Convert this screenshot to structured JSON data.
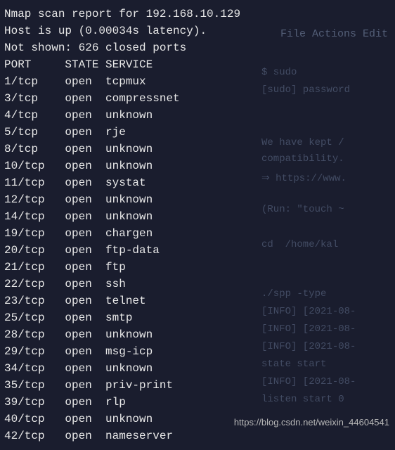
{
  "header": {
    "line1": "Nmap scan report for 192.168.10.129",
    "line2": "Host is up (0.00034s latency).",
    "line3": "Not shown: 626 closed ports"
  },
  "table_header": {
    "port": "PORT",
    "state": "STATE",
    "service": "SERVICE"
  },
  "ports": [
    {
      "port": "1/tcp",
      "state": "open",
      "service": "tcpmux"
    },
    {
      "port": "3/tcp",
      "state": "open",
      "service": "compressnet"
    },
    {
      "port": "4/tcp",
      "state": "open",
      "service": "unknown"
    },
    {
      "port": "5/tcp",
      "state": "open",
      "service": "rje"
    },
    {
      "port": "8/tcp",
      "state": "open",
      "service": "unknown"
    },
    {
      "port": "10/tcp",
      "state": "open",
      "service": "unknown"
    },
    {
      "port": "11/tcp",
      "state": "open",
      "service": "systat"
    },
    {
      "port": "12/tcp",
      "state": "open",
      "service": "unknown"
    },
    {
      "port": "14/tcp",
      "state": "open",
      "service": "unknown"
    },
    {
      "port": "19/tcp",
      "state": "open",
      "service": "chargen"
    },
    {
      "port": "20/tcp",
      "state": "open",
      "service": "ftp-data"
    },
    {
      "port": "21/tcp",
      "state": "open",
      "service": "ftp"
    },
    {
      "port": "22/tcp",
      "state": "open",
      "service": "ssh"
    },
    {
      "port": "23/tcp",
      "state": "open",
      "service": "telnet"
    },
    {
      "port": "25/tcp",
      "state": "open",
      "service": "smtp"
    },
    {
      "port": "28/tcp",
      "state": "open",
      "service": "unknown"
    },
    {
      "port": "29/tcp",
      "state": "open",
      "service": "msg-icp"
    },
    {
      "port": "34/tcp",
      "state": "open",
      "service": "unknown"
    },
    {
      "port": "35/tcp",
      "state": "open",
      "service": "priv-print"
    },
    {
      "port": "39/tcp",
      "state": "open",
      "service": "rlp"
    },
    {
      "port": "40/tcp",
      "state": "open",
      "service": "unknown"
    },
    {
      "port": "42/tcp",
      "state": "open",
      "service": "nameserver"
    }
  ],
  "watermark": "https://blog.csdn.net/weixin_44604541",
  "background": {
    "menu": "File  Actions  Edit",
    "sudo": "$ sudo",
    "password": "[sudo] password",
    "kept": "We have kept /",
    "compat": "compatibility.",
    "https": "⇒ https://www.",
    "run": "(Run: \"touch ~",
    "cd": "cd  /home/kal",
    "spp": "./spp -type",
    "info1": "[INFO] [2021-08-",
    "info2": "[INFO] [2021-08-",
    "info3": "[INFO] [2021-08-",
    "state": "state start",
    "info4": "[INFO] [2021-08-",
    "listen": "listen start 0"
  }
}
